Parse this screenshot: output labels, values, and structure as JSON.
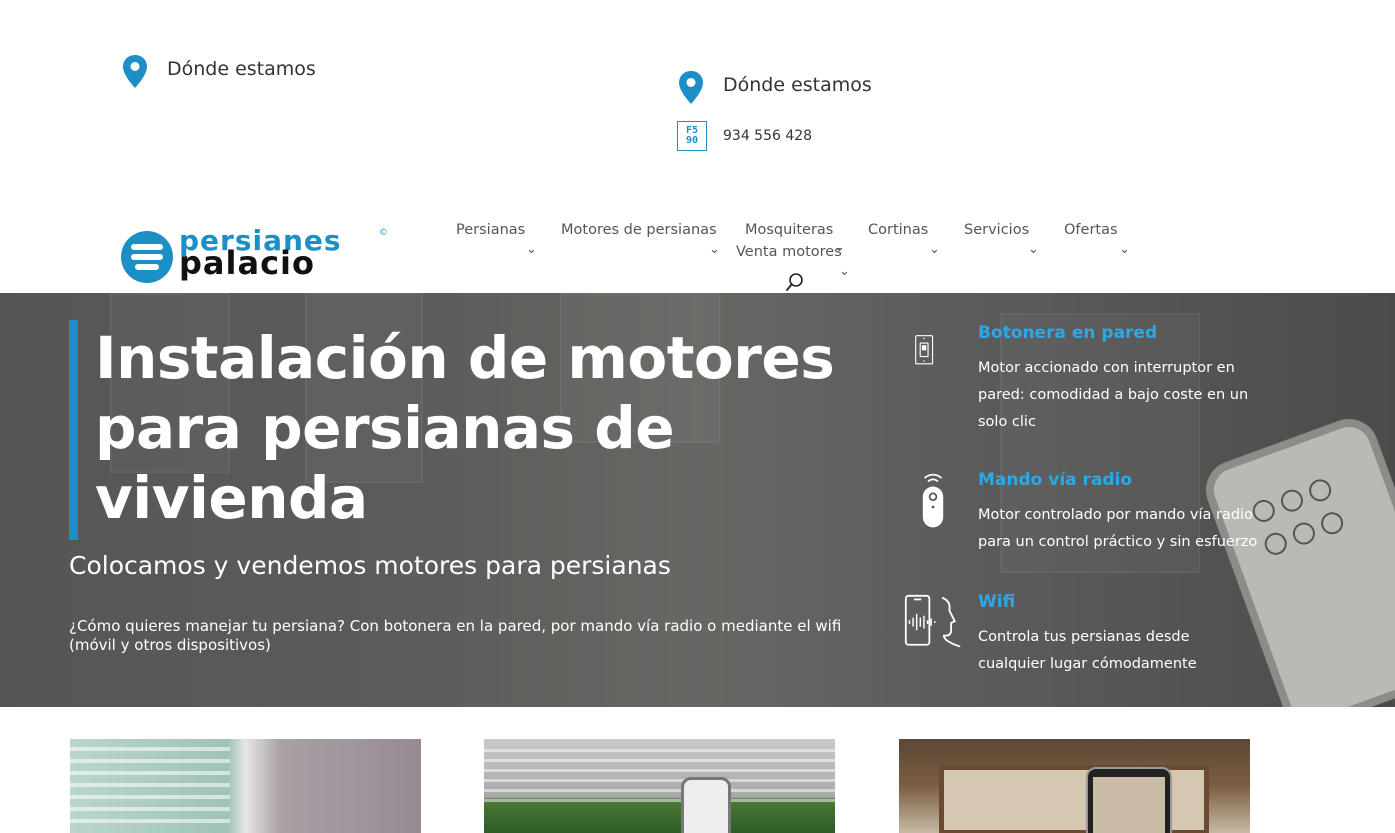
{
  "topbar": {
    "location1_label": "Dónde estamos",
    "location2_label": "Dónde estamos",
    "phone_icon_text": "F5\n90",
    "phone_number": "934 556 428"
  },
  "logo": {
    "word1": "persianes",
    "word2": "palacio",
    "copyright": "©"
  },
  "nav": {
    "items": [
      {
        "label": "Persianas"
      },
      {
        "label": "Motores de persianas"
      },
      {
        "label": "Mosquiteras"
      },
      {
        "label": "Cortinas"
      },
      {
        "label": "Servicios"
      },
      {
        "label": "Ofertas"
      },
      {
        "label": "Venta motores"
      }
    ],
    "chevron": "⌄",
    "search_icon": "search-icon"
  },
  "hero": {
    "title": "Instalación de motores para persianas de vivienda",
    "subtitle": "Colocamos y vendemos motores para persianas",
    "description": "¿Cómo quieres manejar tu persiana? Con botonera en la pared, por mando vía radio o mediante el wifi (móvil y otros dispositivos)",
    "accent_color": "#1c8fc7",
    "features": [
      {
        "icon": "wall-switch-icon",
        "title": "Botonera en pared",
        "body": "Motor accionado con interruptor en pared: comodidad a bajo coste en un solo clic"
      },
      {
        "icon": "radio-remote-icon",
        "title": "Mando vía radio",
        "body": "Motor controlado por mando vía radio para un control práctico y sin esfuerzo"
      },
      {
        "icon": "wifi-voice-icon",
        "title": "Wifi",
        "body": "Controla tus persianas desde cualquier lugar cómodamente"
      }
    ],
    "feature_title_color": "#2aa8e8"
  },
  "colors": {
    "brand_blue": "#1c8fc7",
    "text_dark": "#333333"
  }
}
